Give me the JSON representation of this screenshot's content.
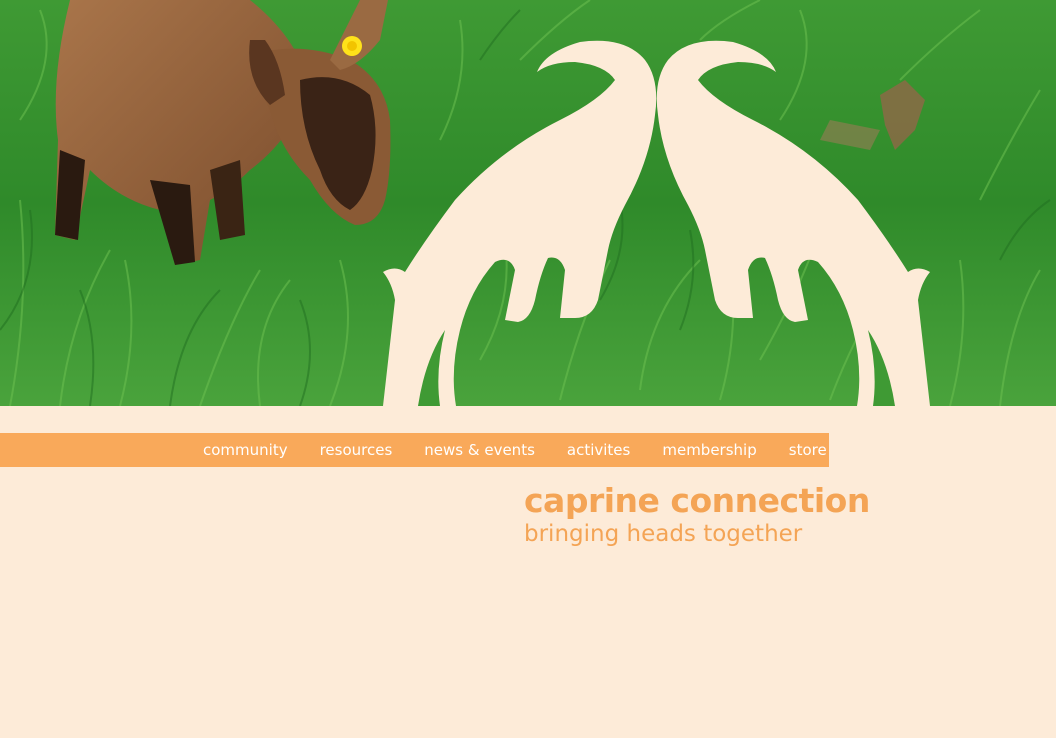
{
  "hero": {
    "photo": "goat-kid-in-grass-photo",
    "logo": "two-goats-heads-together-logo"
  },
  "nav": {
    "items": [
      {
        "label": "community"
      },
      {
        "label": "resources"
      },
      {
        "label": "news & events"
      },
      {
        "label": "activites"
      },
      {
        "label": "membership"
      },
      {
        "label": "store"
      }
    ]
  },
  "brand": {
    "title": "caprine connection",
    "tagline": "bringing heads together"
  },
  "colors": {
    "background": "#fdebd8",
    "accent": "#f9a95a",
    "brand_text": "#f4a455",
    "logo_fill": "#fdebd8"
  }
}
